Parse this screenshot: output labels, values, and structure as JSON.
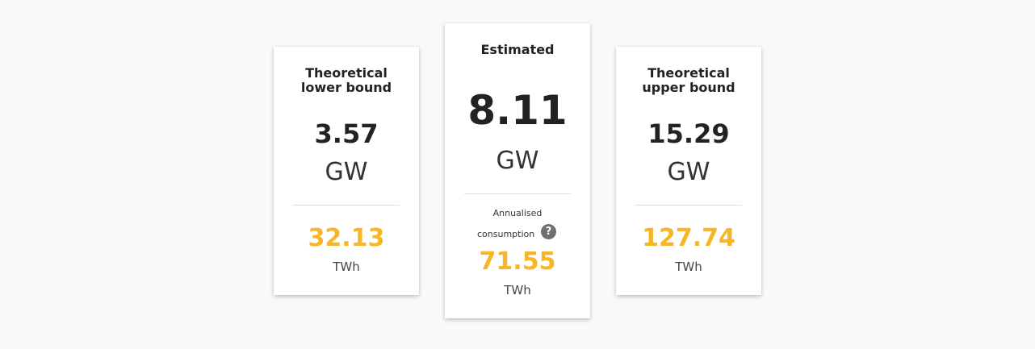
{
  "accent_color": "#f8b626",
  "cards": [
    {
      "title_line1": "Theoretical",
      "title_line2": "lower bound",
      "power_value": "3.57",
      "power_unit": "GW",
      "energy_value": "32.13",
      "energy_unit": "TWh"
    },
    {
      "title_line1": "Estimated",
      "power_value": "8.11",
      "power_unit": "GW",
      "consumption_label_line1": "Annualised",
      "consumption_label_line2": "consumption",
      "help_icon": "question-circle-icon",
      "help_glyph": "?",
      "energy_value": "71.55",
      "energy_unit": "TWh"
    },
    {
      "title_line1": "Theoretical",
      "title_line2": "upper bound",
      "power_value": "15.29",
      "power_unit": "GW",
      "energy_value": "127.74",
      "energy_unit": "TWh"
    }
  ]
}
